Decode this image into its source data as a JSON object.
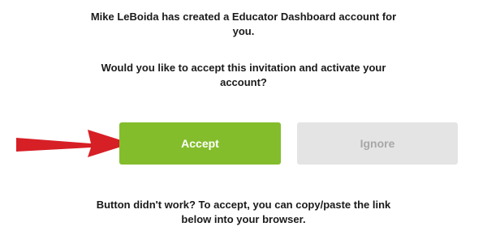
{
  "invitation": {
    "message_line1": "Mike LeBoida has created a Educator Dashboard account for",
    "message_line2": "you.",
    "question_line1": "Would you like to accept this invitation and activate your",
    "question_line2": "account?"
  },
  "actions": {
    "accept_label": "Accept",
    "ignore_label": "Ignore"
  },
  "footer": {
    "line1": "Button didn't work? To accept, you can copy/paste the link",
    "line2": "below into your browser."
  },
  "colors": {
    "accept": "#83bd2c",
    "ignore": "#e4e4e4",
    "arrow": "#d71f26"
  }
}
